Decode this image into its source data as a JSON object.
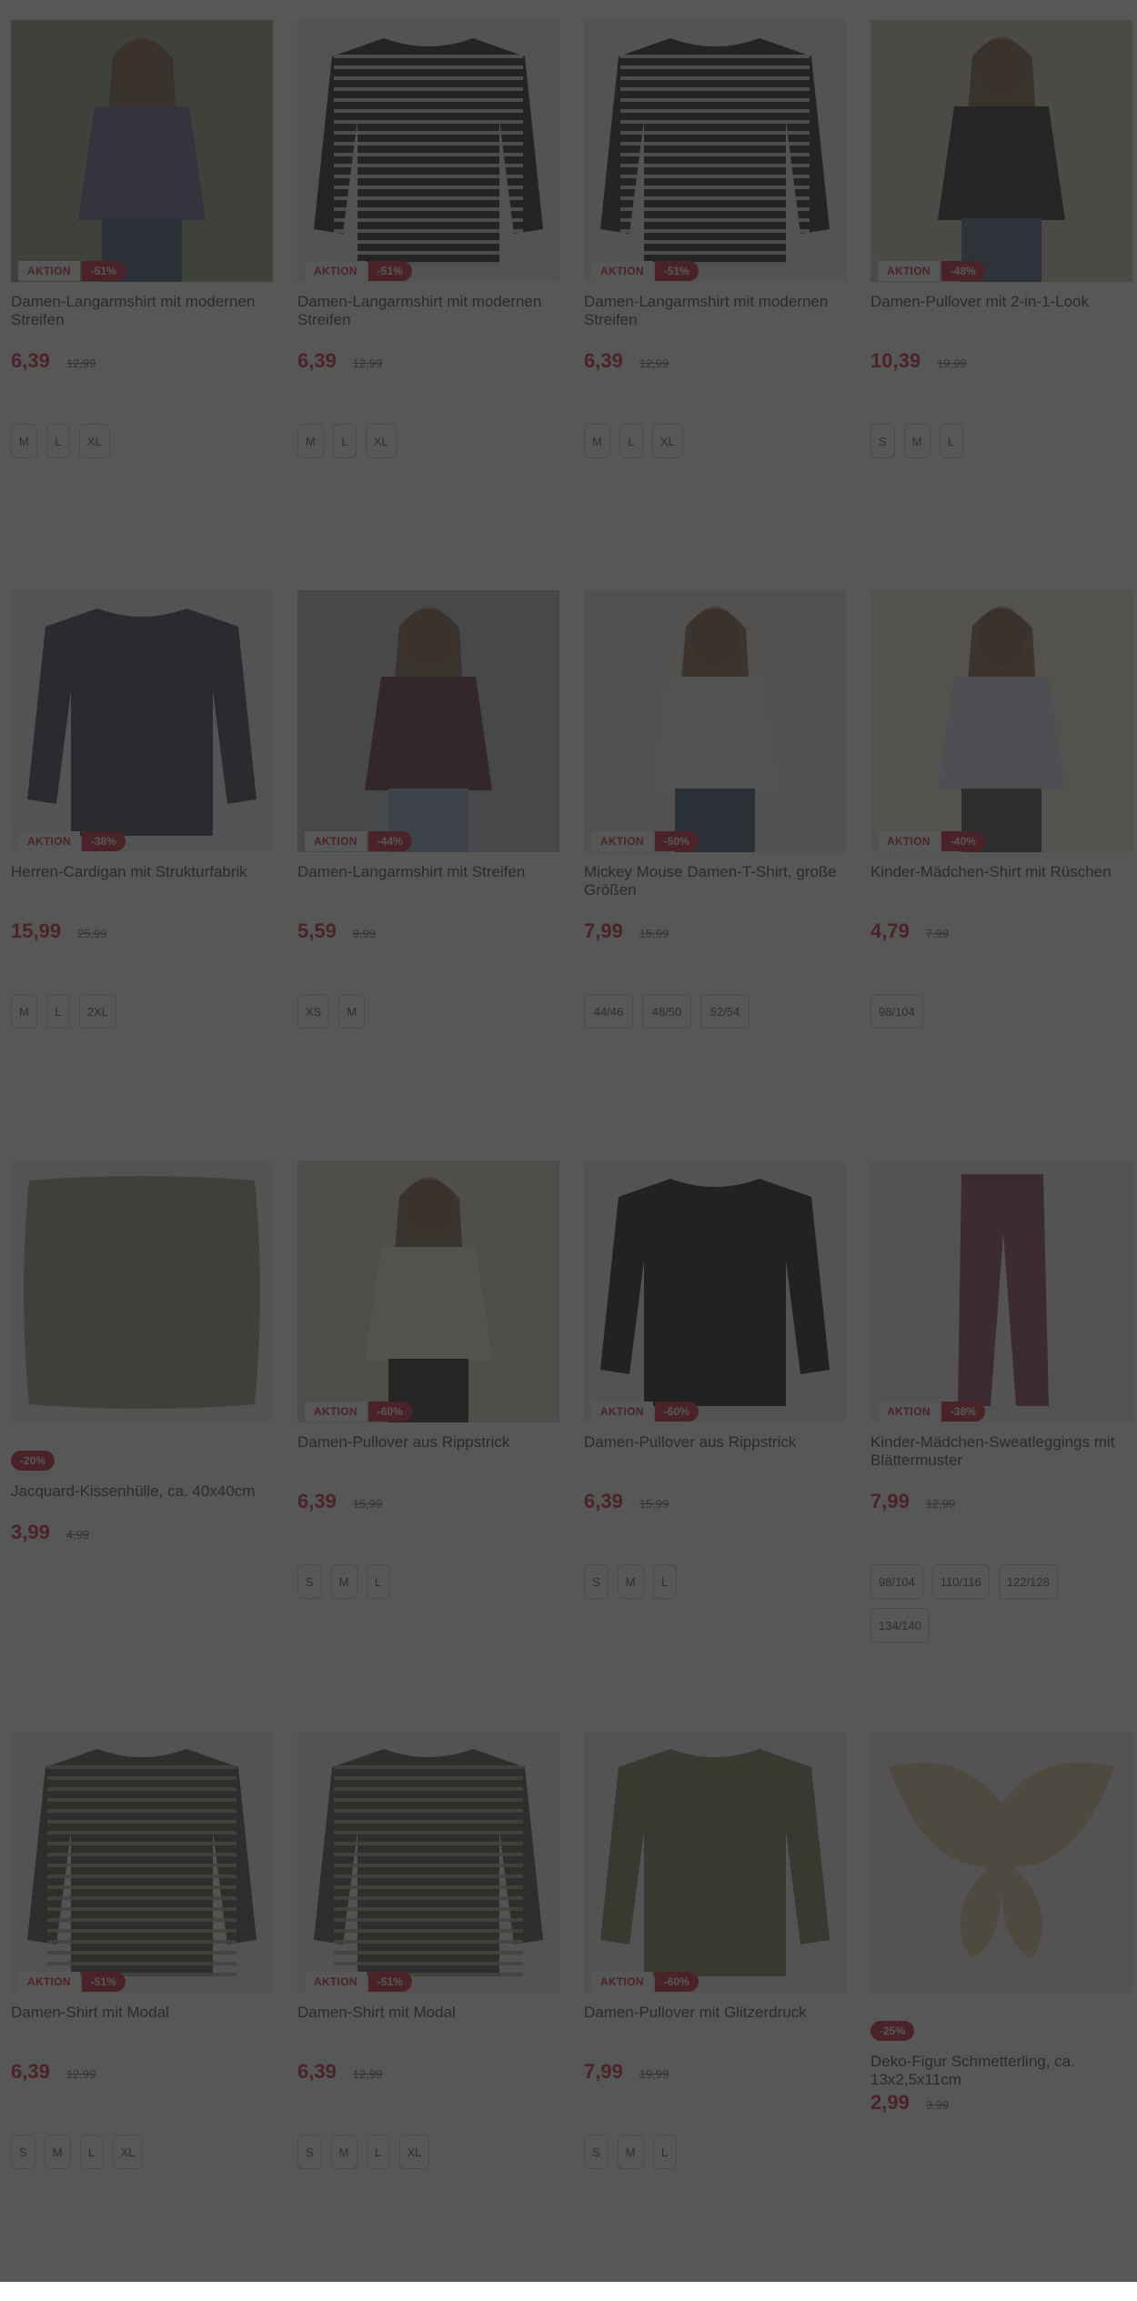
{
  "badge_aktion": "AKTION",
  "products": [
    {
      "title": "Damen-Langarmshirt mit modernen Streifen",
      "price": "6,39",
      "old_price": "12,99",
      "badge": "-51%",
      "aktion": true,
      "sizes": [
        "M",
        "L",
        "XL"
      ],
      "icon": "striped-shirt-model-image"
    },
    {
      "title": "Damen-Langarmshirt mit modernen Streifen",
      "price": "6,39",
      "old_price": "12,99",
      "badge": "-51%",
      "aktion": true,
      "sizes": [
        "M",
        "L",
        "XL"
      ],
      "icon": "striped-shirt-image"
    },
    {
      "title": "Damen-Langarmshirt mit modernen Streifen",
      "price": "6,39",
      "old_price": "12,99",
      "badge": "-51%",
      "aktion": true,
      "sizes": [
        "M",
        "L",
        "XL"
      ],
      "icon": "striped-shirt-image"
    },
    {
      "title": "Damen-Pullover mit 2-in-1-Look",
      "price": "10,39",
      "old_price": "19,99",
      "badge": "-48%",
      "aktion": true,
      "sizes": [
        "S",
        "M",
        "L"
      ],
      "icon": "pullover-model-image"
    },
    {
      "title": "Herren-Cardigan mit Strukturfabrik",
      "price": "15,99",
      "old_price": "25,99",
      "badge": "-38%",
      "aktion": true,
      "sizes": [
        "M",
        "L",
        "2XL"
      ],
      "icon": "cardigan-image"
    },
    {
      "title": "Damen-Langarmshirt mit Streifen",
      "price": "5,59",
      "old_price": "9,99",
      "badge": "-44%",
      "aktion": true,
      "sizes": [
        "XS",
        "M"
      ],
      "icon": "longsleeve-model-image"
    },
    {
      "title": "Mickey Mouse Damen-T-Shirt, große Größen",
      "price": "7,99",
      "old_price": "15,99",
      "badge": "-50%",
      "aktion": true,
      "sizes": [
        "44/46",
        "48/50",
        "52/54"
      ],
      "icon": "tshirt-model-image"
    },
    {
      "title": "Kinder-Mädchen-Shirt mit Rüschen",
      "price": "4,79",
      "old_price": "7,99",
      "badge": "-40%",
      "aktion": true,
      "sizes": [
        "98/104"
      ],
      "icon": "kids-shirt-model-image"
    },
    {
      "title": "Jacquard-Kissenhülle, ca. 40x40cm",
      "price": "3,99",
      "old_price": "4,99",
      "badge": "-20%",
      "aktion": false,
      "sizes": [],
      "icon": "cushion-cover-image"
    },
    {
      "title": "Damen-Pullover aus Rippstrick",
      "price": "6,39",
      "old_price": "15,99",
      "badge": "-60%",
      "aktion": true,
      "sizes": [
        "S",
        "M",
        "L"
      ],
      "icon": "rib-pullover-model-image"
    },
    {
      "title": "Damen-Pullover aus Rippstrick",
      "price": "6,39",
      "old_price": "15,99",
      "badge": "-60%",
      "aktion": true,
      "sizes": [
        "S",
        "M",
        "L"
      ],
      "icon": "rib-pullover-image"
    },
    {
      "title": "Kinder-Mädchen-Sweatleggings mit Blättermuster",
      "price": "7,99",
      "old_price": "12,99",
      "badge": "-38%",
      "aktion": true,
      "sizes": [
        "98/104",
        "110/116",
        "122/128",
        "134/140"
      ],
      "icon": "leggings-image"
    },
    {
      "title": "Damen-Shirt mit Modal",
      "price": "6,39",
      "old_price": "12,99",
      "badge": "-51%",
      "aktion": true,
      "sizes": [
        "S",
        "M",
        "L",
        "XL"
      ],
      "icon": "modal-shirt-image"
    },
    {
      "title": "Damen-Shirt mit Modal",
      "price": "6,39",
      "old_price": "12,99",
      "badge": "-51%",
      "aktion": true,
      "sizes": [
        "S",
        "M",
        "L",
        "XL"
      ],
      "icon": "modal-shirt-image"
    },
    {
      "title": "Damen-Pullover mit Glitzerdruck",
      "price": "7,99",
      "old_price": "19,99",
      "badge": "-60%",
      "aktion": true,
      "sizes": [
        "S",
        "M",
        "L"
      ],
      "icon": "glitter-pullover-image"
    },
    {
      "title": "Deko-Figur Schmetterling, ca. 13x2,5x11cm",
      "price": "2,99",
      "old_price": "3,99",
      "badge": "-25%",
      "aktion": false,
      "sizes": [],
      "icon": "butterfly-figure-image"
    }
  ],
  "colors": {
    "accent": "#c0142b",
    "overlay": "rgba(40,40,40,0.78)"
  }
}
